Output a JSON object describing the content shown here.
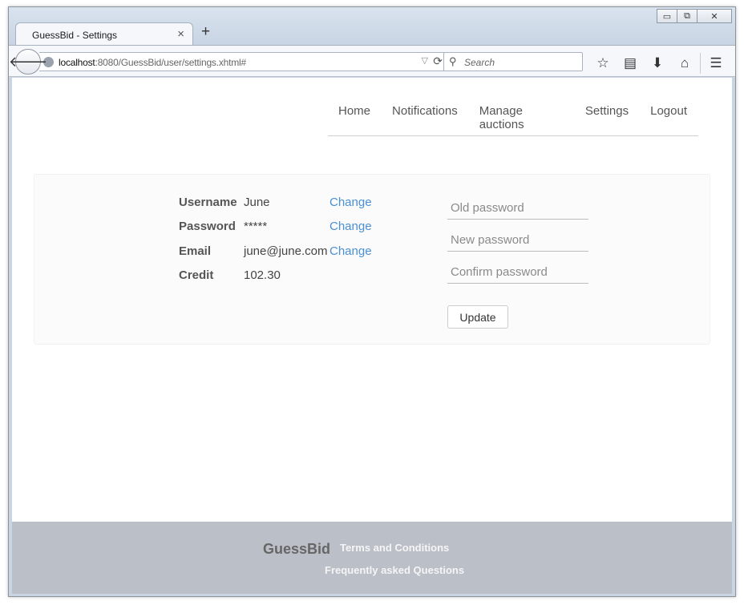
{
  "browser": {
    "tab_title": "GuessBid - Settings",
    "tab_close": "×",
    "new_tab": "+",
    "url_host": "localhost",
    "url_rest": ":8080/GuessBid/user/settings.xhtml#",
    "search_placeholder": "Search"
  },
  "nav": {
    "items": [
      "Home",
      "Notifications",
      "Manage auctions",
      "Settings",
      "Logout"
    ]
  },
  "account": {
    "username_label": "Username",
    "username_value": "June",
    "password_label": "Password",
    "password_value": "*****",
    "email_label": "Email",
    "email_value": "june@june.com",
    "credit_label": "Credit",
    "credit_value": "102.30",
    "change_label": "Change"
  },
  "password_form": {
    "old_placeholder": "Old password",
    "new_placeholder": "New password",
    "confirm_placeholder": "Confirm password",
    "update_label": "Update"
  },
  "footer": {
    "brand": "GuessBid",
    "terms": "Terms and Conditions",
    "faq": "Frequently asked Questions"
  }
}
